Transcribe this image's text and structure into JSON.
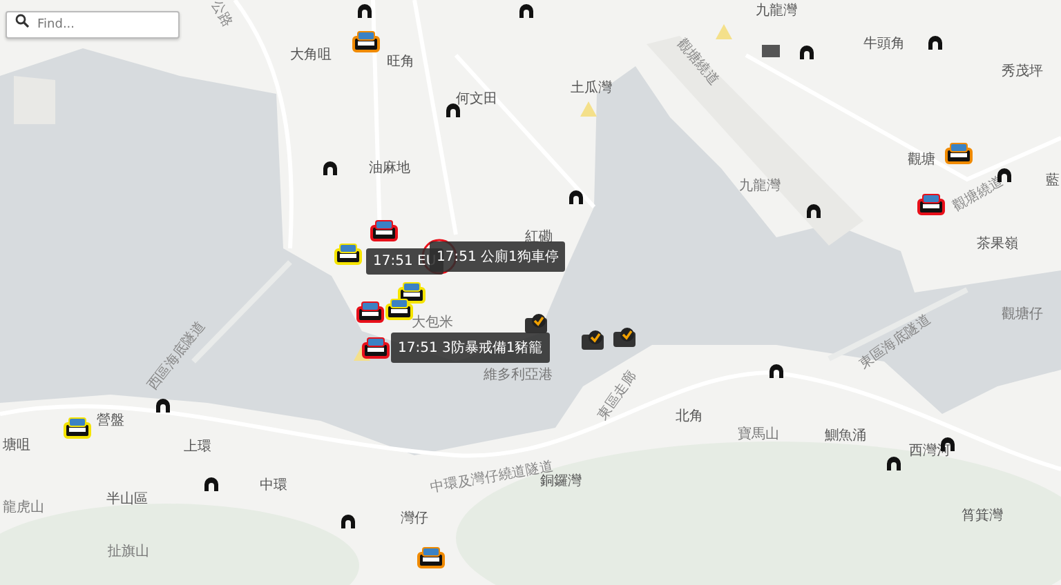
{
  "search": {
    "placeholder": "Find..."
  },
  "place_labels": [
    {
      "text": "公路",
      "kind": "road"
    },
    {
      "text": "大角咀",
      "kind": "district"
    },
    {
      "text": "旺角",
      "kind": "district"
    },
    {
      "text": "何文田",
      "kind": "district"
    },
    {
      "text": "油麻地",
      "kind": "district"
    },
    {
      "text": "九龍灣",
      "kind": "district"
    },
    {
      "text": "觀塘繞道",
      "kind": "road"
    },
    {
      "text": "牛頭角",
      "kind": "district"
    },
    {
      "text": "秀茂坪",
      "kind": "district"
    },
    {
      "text": "土瓜灣",
      "kind": "district"
    },
    {
      "text": "觀塘",
      "kind": "district"
    },
    {
      "text": "九龍灣",
      "kind": "small"
    },
    {
      "text": "觀塘繞道",
      "kind": "road"
    },
    {
      "text": "藍",
      "kind": "district"
    },
    {
      "text": "紅磡",
      "kind": "district"
    },
    {
      "text": "茶果嶺",
      "kind": "district"
    },
    {
      "text": "觀塘仔",
      "kind": "small"
    },
    {
      "text": "西區海底隧道",
      "kind": "road"
    },
    {
      "text": "大包米",
      "kind": "small"
    },
    {
      "text": "維多利亞港",
      "kind": "small"
    },
    {
      "text": "東區走廊",
      "kind": "road"
    },
    {
      "text": "東區海底隧道",
      "kind": "road"
    },
    {
      "text": "營盤",
      "kind": "district"
    },
    {
      "text": "塘咀",
      "kind": "district"
    },
    {
      "text": "上環",
      "kind": "district"
    },
    {
      "text": "北角",
      "kind": "district"
    },
    {
      "text": "寶馬山",
      "kind": "small"
    },
    {
      "text": "鰂魚涌",
      "kind": "district"
    },
    {
      "text": "西灣河",
      "kind": "district"
    },
    {
      "text": "中環",
      "kind": "district"
    },
    {
      "text": "中環及灣仔繞道隧道",
      "kind": "road"
    },
    {
      "text": "銅鑼灣",
      "kind": "district"
    },
    {
      "text": "半山區",
      "kind": "district"
    },
    {
      "text": "龍虎山",
      "kind": "small"
    },
    {
      "text": "灣仔",
      "kind": "district"
    },
    {
      "text": "筲箕灣",
      "kind": "district"
    },
    {
      "text": "扯旗山",
      "kind": "small"
    }
  ],
  "markers": [
    {
      "kind": "tunnel"
    },
    {
      "kind": "tunnel"
    },
    {
      "kind": "tunnel"
    },
    {
      "kind": "tunnel"
    },
    {
      "kind": "tunnel"
    },
    {
      "kind": "tunnel"
    },
    {
      "kind": "tunnel"
    },
    {
      "kind": "tunnel"
    },
    {
      "kind": "tunnel"
    },
    {
      "kind": "tunnel"
    },
    {
      "kind": "tunnel"
    },
    {
      "kind": "tunnel"
    },
    {
      "kind": "tunnel"
    },
    {
      "kind": "tunnel"
    },
    {
      "kind": "tunnel"
    },
    {
      "kind": "warning"
    },
    {
      "kind": "warning"
    },
    {
      "kind": "warning"
    },
    {
      "kind": "flag"
    },
    {
      "kind": "camera"
    },
    {
      "kind": "camera"
    },
    {
      "kind": "camera"
    },
    {
      "kind": "ring"
    },
    {
      "kind": "police-car",
      "color": "#f08a00"
    },
    {
      "kind": "police-car",
      "color": "#f08a00"
    },
    {
      "kind": "police-car",
      "color": "#e8101a"
    },
    {
      "kind": "police-car",
      "color": "#f5e400"
    },
    {
      "kind": "police-car",
      "color": "#f08a00"
    },
    {
      "kind": "police-car",
      "color": "#f5e400"
    },
    {
      "kind": "police-car",
      "color": "#e8101a"
    },
    {
      "kind": "police-car",
      "color": "#f5e400"
    },
    {
      "kind": "police-car",
      "color": "#e8101a"
    },
    {
      "kind": "police-car",
      "color": "#f5e400"
    },
    {
      "kind": "police-car",
      "color": "#e8101a"
    }
  ],
  "popups": [
    {
      "text": "17:51 EU"
    },
    {
      "text": "17:51 公廁1狗車停"
    },
    {
      "text": "17:51 3防暴戒備1豬籠"
    }
  ]
}
